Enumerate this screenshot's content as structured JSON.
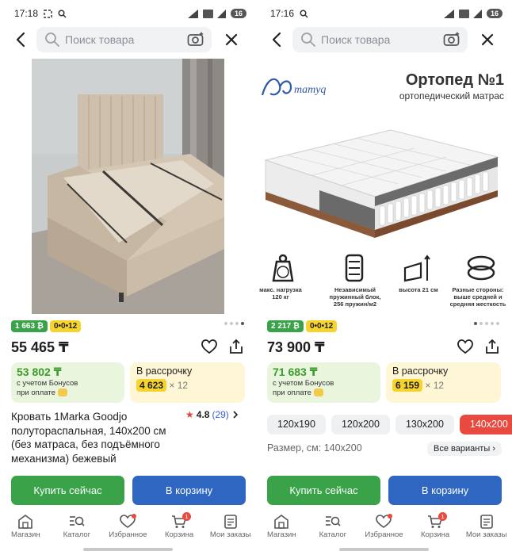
{
  "left": {
    "status": {
      "time": "17:18",
      "battery": "16"
    },
    "search": {
      "placeholder": "Поиск товара"
    },
    "badges": {
      "bonus": "1 663 ₿",
      "installment": "0•0•12"
    },
    "price": "55 465 ₸",
    "bonus": {
      "value": "53 802 ₸",
      "line1": "с учетом Бонусов",
      "line2": "при оплате"
    },
    "installment": {
      "title": "В рассрочку",
      "amount": "4 623",
      "months": "× 12"
    },
    "title": "Кровать 1Marka Goodjo полуторaспальная, 140х200 см (без матраса, без подъёмного механизма) бежевый",
    "rating": {
      "value": "4.8",
      "count": "(29)"
    },
    "buttons": {
      "buy": "Купить сейчас",
      "cart": "В корзину"
    }
  },
  "right": {
    "status": {
      "time": "17:16",
      "battery": "16"
    },
    "search": {
      "placeholder": "Поиск товара"
    },
    "banner": {
      "brand": "AQmamyq",
      "title": "Ортопед №1",
      "subtitle": "ортопедический матрас"
    },
    "features": [
      {
        "line1": "макс. нагрузка",
        "line2": "120 кг"
      },
      {
        "line1": "Независимый",
        "line2": "пружинный блок,",
        "line3": "256 пружин/м2"
      },
      {
        "line1": "высота 21 см"
      },
      {
        "line1": "Разные стороны:",
        "line2": "выше средней и",
        "line3": "средняя жесткость"
      }
    ],
    "badges": {
      "bonus": "2 217 ₿",
      "installment": "0•0•12"
    },
    "price": "73 900 ₸",
    "bonus": {
      "value": "71 683 ₸",
      "line1": "с учетом Бонусов",
      "line2": "при оплате"
    },
    "installment": {
      "title": "В рассрочку",
      "amount": "6 159",
      "months": "× 12"
    },
    "sizes": [
      "120x190",
      "120x200",
      "130x200",
      "140x200"
    ],
    "size_label": "Размер, см: 140x200",
    "all_variants": "Все варианты",
    "buttons": {
      "buy": "Купить сейчас",
      "cart": "В корзину"
    }
  },
  "tabs": {
    "home": "Магазин",
    "catalog": "Каталог",
    "favorites": "Избранное",
    "cart": "Корзина",
    "cart_count": "1",
    "orders": "Мои заказы"
  },
  "colors": {
    "green": "#3aa34a",
    "blue": "#2f66c2",
    "red": "#e94a3f",
    "yellow": "#f6d32d"
  }
}
